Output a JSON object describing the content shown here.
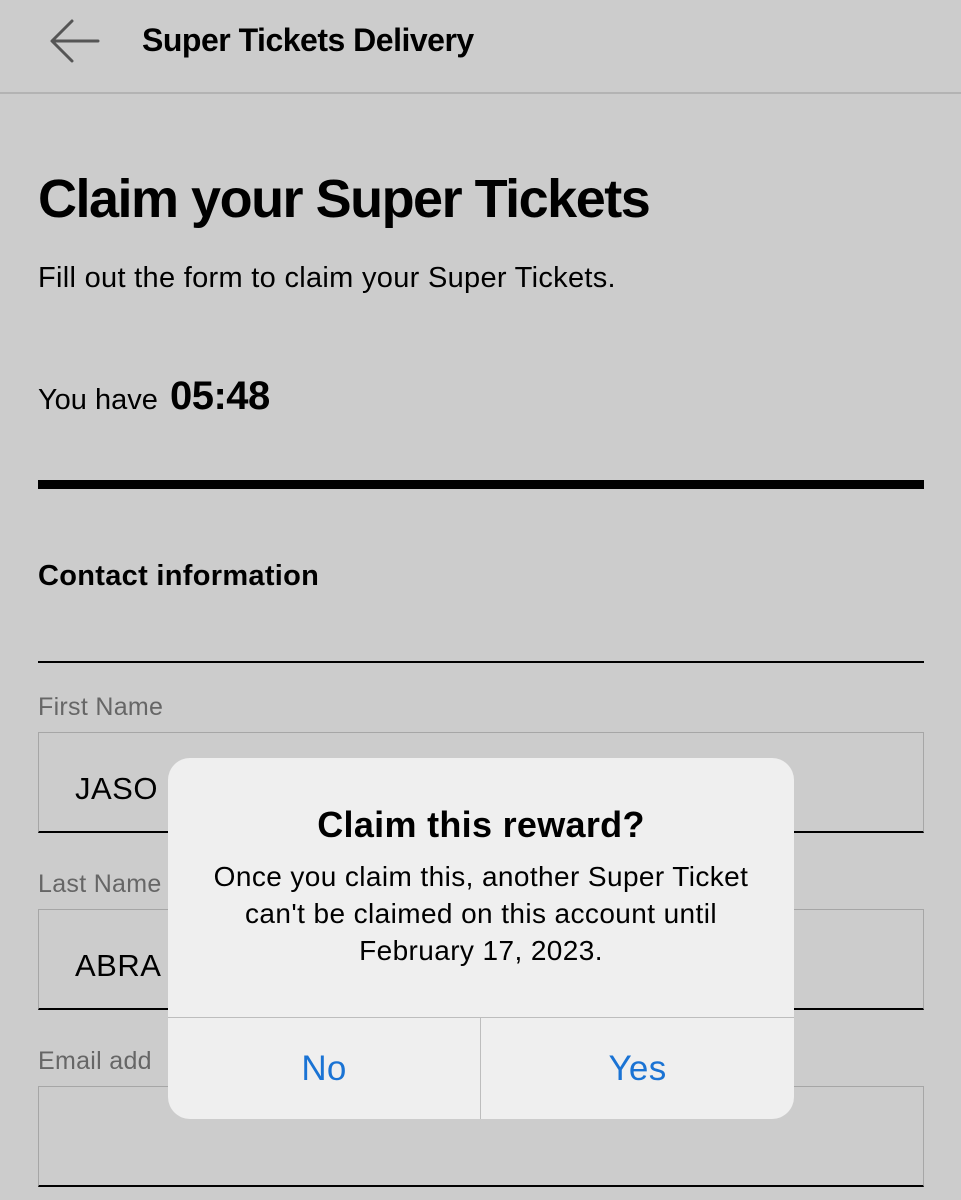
{
  "header": {
    "title": "Super Tickets Delivery",
    "back_icon": "arrow-left-icon"
  },
  "page": {
    "title": "Claim your Super Tickets",
    "subtitle": "Fill out the form to claim your Super Tickets.",
    "timer_prefix": "You have",
    "timer_value": "05:48"
  },
  "contact": {
    "section_title": "Contact information",
    "fields": [
      {
        "label": "First Name",
        "value": "JASO"
      },
      {
        "label": "Last Name",
        "value": "ABRA"
      },
      {
        "label": "Email add",
        "value": ""
      }
    ]
  },
  "dialog": {
    "title": "Claim this reward?",
    "message": "Once you claim this, another Super Ticket can't be claimed on this account until February 17, 2023.",
    "no_label": "No",
    "yes_label": "Yes",
    "button_color": "#1a73d4"
  }
}
